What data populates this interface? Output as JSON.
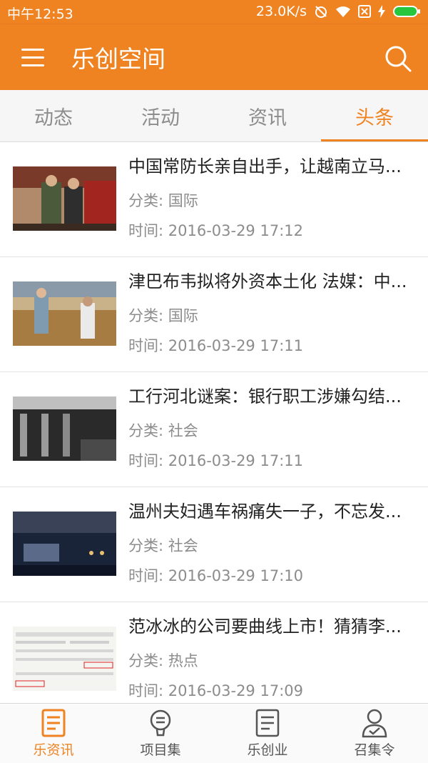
{
  "status_bar": {
    "time": "中午12:53",
    "speed": "23.0K/s"
  },
  "app_bar": {
    "title": "乐创空间"
  },
  "tabs": [
    {
      "label": "动态"
    },
    {
      "label": "活动"
    },
    {
      "label": "资讯"
    },
    {
      "label": "头条"
    }
  ],
  "news": [
    {
      "title": "中国常防长亲自出手，让越南立马...",
      "category": "分类: 国际",
      "time": "时间: 2016-03-29 17:12"
    },
    {
      "title": "津巴布韦拟将外资本土化 法媒：中...",
      "category": "分类: 国际",
      "time": "时间: 2016-03-29 17:11"
    },
    {
      "title": "工行河北谜案：银行职工涉嫌勾结...",
      "category": "分类: 社会",
      "time": "时间: 2016-03-29 17:11"
    },
    {
      "title": "温州夫妇遇车祸痛失一子，不忘发...",
      "category": "分类: 社会",
      "time": "时间: 2016-03-29 17:10"
    },
    {
      "title": "范冰冰的公司要曲线上市！猜猜李...",
      "category": "分类: 热点",
      "time": "时间: 2016-03-29 17:09"
    }
  ],
  "bottom_nav": [
    {
      "label": "乐资讯"
    },
    {
      "label": "项目集"
    },
    {
      "label": "乐创业"
    },
    {
      "label": "召集令"
    }
  ],
  "colors": {
    "accent": "#ef8322"
  }
}
